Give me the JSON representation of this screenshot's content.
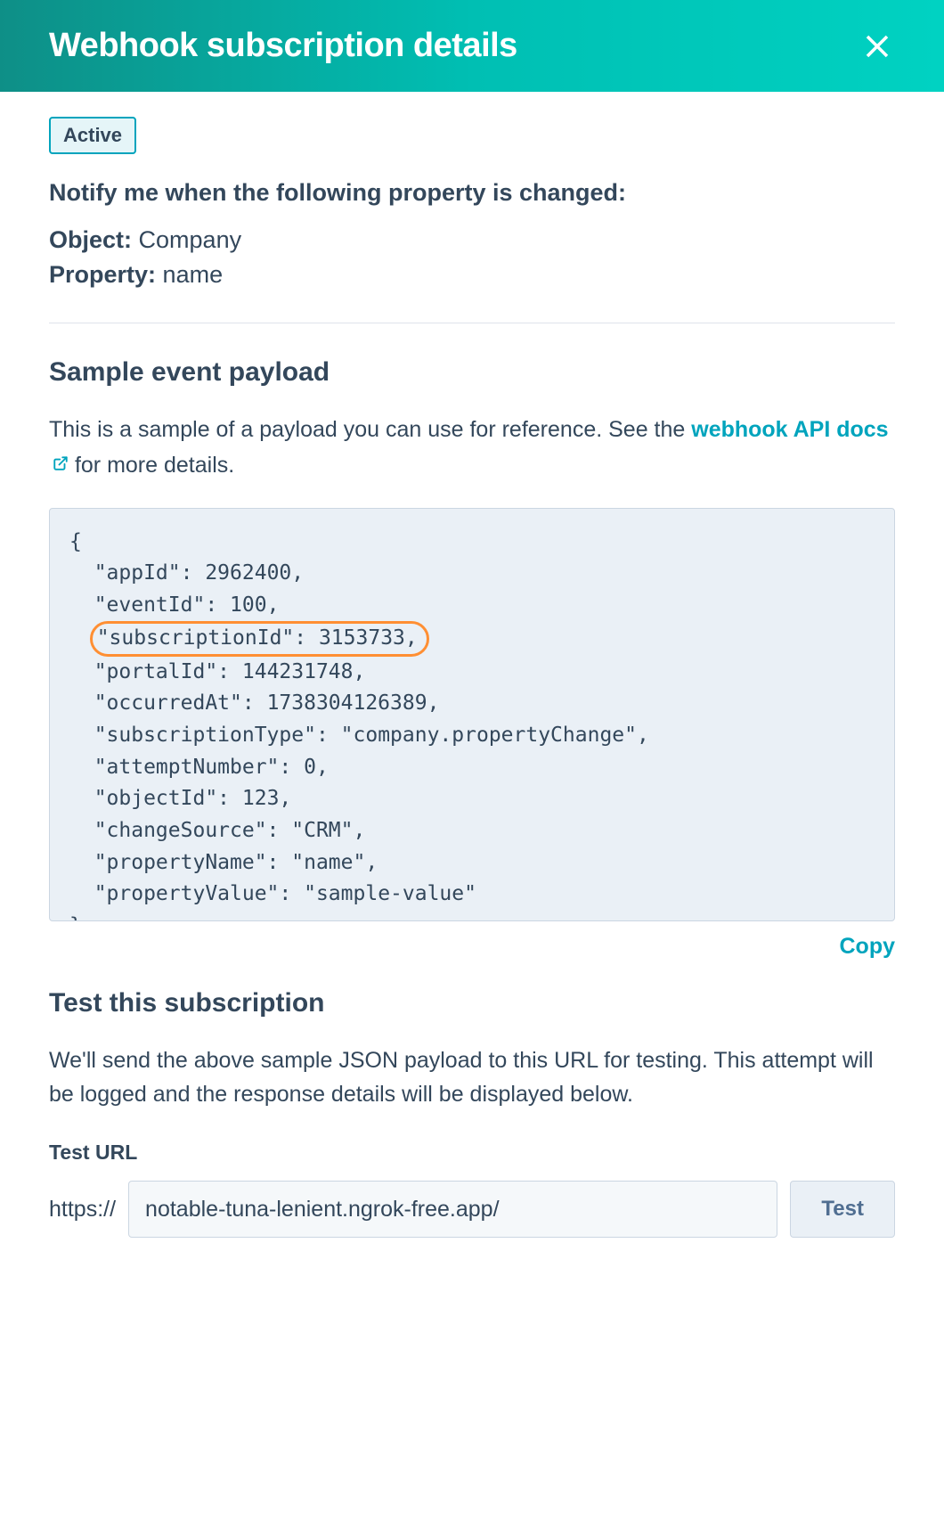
{
  "header": {
    "title": "Webhook subscription details"
  },
  "status": {
    "badge": "Active"
  },
  "notify": {
    "heading": "Notify me when the following property is changed:",
    "objectLabel": "Object:",
    "objectValue": "Company",
    "propertyLabel": "Property:",
    "propertyValue": "name"
  },
  "sample": {
    "title": "Sample event payload",
    "descPrefix": "This is a sample of a payload you can use for reference. See the ",
    "linkText": "webhook API docs",
    "descSuffix": " for more details.",
    "copy": "Copy",
    "payload": {
      "appId": 2962400,
      "eventId": 100,
      "subscriptionId": 3153733,
      "portalId": 144231748,
      "occurredAt": 1738304126389,
      "subscriptionType": "company.propertyChange",
      "attemptNumber": 0,
      "objectId": 123,
      "changeSource": "CRM",
      "propertyName": "name",
      "propertyValue": "sample-value"
    }
  },
  "test": {
    "title": "Test this subscription",
    "desc": "We'll send the above sample JSON payload to this URL for testing. This attempt will be logged and the response details will be displayed below.",
    "urlLabel": "Test URL",
    "urlPrefix": "https://",
    "urlValue": "notable-tuna-lenient.ngrok-free.app/",
    "button": "Test"
  }
}
